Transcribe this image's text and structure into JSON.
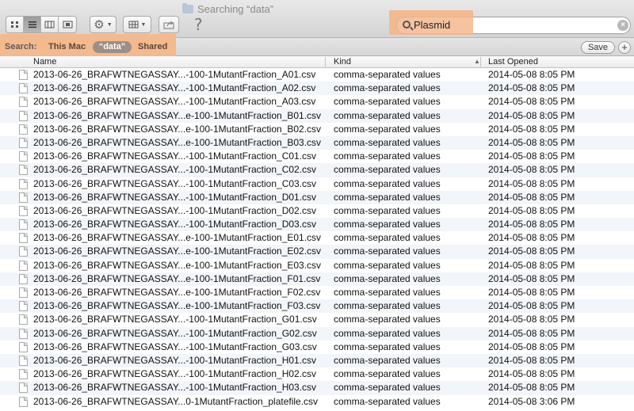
{
  "window": {
    "title": "Searching “data”"
  },
  "toolbar": {
    "view_buttons": [
      {
        "name": "icon-view",
        "icon": "grid-icon",
        "active": false
      },
      {
        "name": "list-view",
        "icon": "list-icon",
        "active": true
      },
      {
        "name": "column-view",
        "icon": "columns-icon",
        "active": false
      },
      {
        "name": "coverflow-view",
        "icon": "coverflow-icon",
        "active": false
      }
    ],
    "help_glyph": "?"
  },
  "search": {
    "value": "Plasmid",
    "clear_glyph": "×"
  },
  "scope": {
    "label": "Search:",
    "items": [
      "This Mac",
      "“data”",
      "Shared"
    ],
    "selected": "“data”",
    "save_label": "Save",
    "add_label": "+"
  },
  "columns": {
    "name": "Name",
    "kind": "Kind",
    "last_opened": "Last Opened"
  },
  "rows": [
    {
      "name": "2013-06-26_BRAFWTNEGASSAY...-100-1MutantFraction_A01.csv",
      "kind": "comma-separated values",
      "opened": "2014-05-08 8:05 PM"
    },
    {
      "name": "2013-06-26_BRAFWTNEGASSAY...-100-1MutantFraction_A02.csv",
      "kind": "comma-separated values",
      "opened": "2014-05-08 8:05 PM"
    },
    {
      "name": "2013-06-26_BRAFWTNEGASSAY...-100-1MutantFraction_A03.csv",
      "kind": "comma-separated values",
      "opened": "2014-05-08 8:05 PM"
    },
    {
      "name": "2013-06-26_BRAFWTNEGASSAY...e-100-1MutantFraction_B01.csv",
      "kind": "comma-separated values",
      "opened": "2014-05-08 8:05 PM"
    },
    {
      "name": "2013-06-26_BRAFWTNEGASSAY...e-100-1MutantFraction_B02.csv",
      "kind": "comma-separated values",
      "opened": "2014-05-08 8:05 PM"
    },
    {
      "name": "2013-06-26_BRAFWTNEGASSAY...e-100-1MutantFraction_B03.csv",
      "kind": "comma-separated values",
      "opened": "2014-05-08 8:05 PM"
    },
    {
      "name": "2013-06-26_BRAFWTNEGASSAY...-100-1MutantFraction_C01.csv",
      "kind": "comma-separated values",
      "opened": "2014-05-08 8:05 PM"
    },
    {
      "name": "2013-06-26_BRAFWTNEGASSAY...-100-1MutantFraction_C02.csv",
      "kind": "comma-separated values",
      "opened": "2014-05-08 8:05 PM"
    },
    {
      "name": "2013-06-26_BRAFWTNEGASSAY...-100-1MutantFraction_C03.csv",
      "kind": "comma-separated values",
      "opened": "2014-05-08 8:05 PM"
    },
    {
      "name": "2013-06-26_BRAFWTNEGASSAY...-100-1MutantFraction_D01.csv",
      "kind": "comma-separated values",
      "opened": "2014-05-08 8:05 PM"
    },
    {
      "name": "2013-06-26_BRAFWTNEGASSAY...-100-1MutantFraction_D02.csv",
      "kind": "comma-separated values",
      "opened": "2014-05-08 8:05 PM"
    },
    {
      "name": "2013-06-26_BRAFWTNEGASSAY...-100-1MutantFraction_D03.csv",
      "kind": "comma-separated values",
      "opened": "2014-05-08 8:05 PM"
    },
    {
      "name": "2013-06-26_BRAFWTNEGASSAY...e-100-1MutantFraction_E01.csv",
      "kind": "comma-separated values",
      "opened": "2014-05-08 8:05 PM"
    },
    {
      "name": "2013-06-26_BRAFWTNEGASSAY...e-100-1MutantFraction_E02.csv",
      "kind": "comma-separated values",
      "opened": "2014-05-08 8:05 PM"
    },
    {
      "name": "2013-06-26_BRAFWTNEGASSAY...e-100-1MutantFraction_E03.csv",
      "kind": "comma-separated values",
      "opened": "2014-05-08 8:05 PM"
    },
    {
      "name": "2013-06-26_BRAFWTNEGASSAY...e-100-1MutantFraction_F01.csv",
      "kind": "comma-separated values",
      "opened": "2014-05-08 8:05 PM"
    },
    {
      "name": "2013-06-26_BRAFWTNEGASSAY...e-100-1MutantFraction_F02.csv",
      "kind": "comma-separated values",
      "opened": "2014-05-08 8:05 PM"
    },
    {
      "name": "2013-06-26_BRAFWTNEGASSAY...e-100-1MutantFraction_F03.csv",
      "kind": "comma-separated values",
      "opened": "2014-05-08 8:05 PM"
    },
    {
      "name": "2013-06-26_BRAFWTNEGASSAY...-100-1MutantFraction_G01.csv",
      "kind": "comma-separated values",
      "opened": "2014-05-08 8:05 PM"
    },
    {
      "name": "2013-06-26_BRAFWTNEGASSAY...-100-1MutantFraction_G02.csv",
      "kind": "comma-separated values",
      "opened": "2014-05-08 8:05 PM"
    },
    {
      "name": "2013-06-26_BRAFWTNEGASSAY...-100-1MutantFraction_G03.csv",
      "kind": "comma-separated values",
      "opened": "2014-05-08 8:05 PM"
    },
    {
      "name": "2013-06-26_BRAFWTNEGASSAY...-100-1MutantFraction_H01.csv",
      "kind": "comma-separated values",
      "opened": "2014-05-08 8:05 PM"
    },
    {
      "name": "2013-06-26_BRAFWTNEGASSAY...-100-1MutantFraction_H02.csv",
      "kind": "comma-separated values",
      "opened": "2014-05-08 8:05 PM"
    },
    {
      "name": "2013-06-26_BRAFWTNEGASSAY...-100-1MutantFraction_H03.csv",
      "kind": "comma-separated values",
      "opened": "2014-05-08 8:05 PM"
    },
    {
      "name": "2013-06-26_BRAFWTNEGASSAY...0-1MutantFraction_platefile.csv",
      "kind": "comma-separated values",
      "opened": "2014-05-08 3:06 PM"
    }
  ],
  "colors": {
    "highlight": "#f3b98f",
    "scope_selected": "#9d8e86",
    "row_alt": "#f2f5fa"
  }
}
